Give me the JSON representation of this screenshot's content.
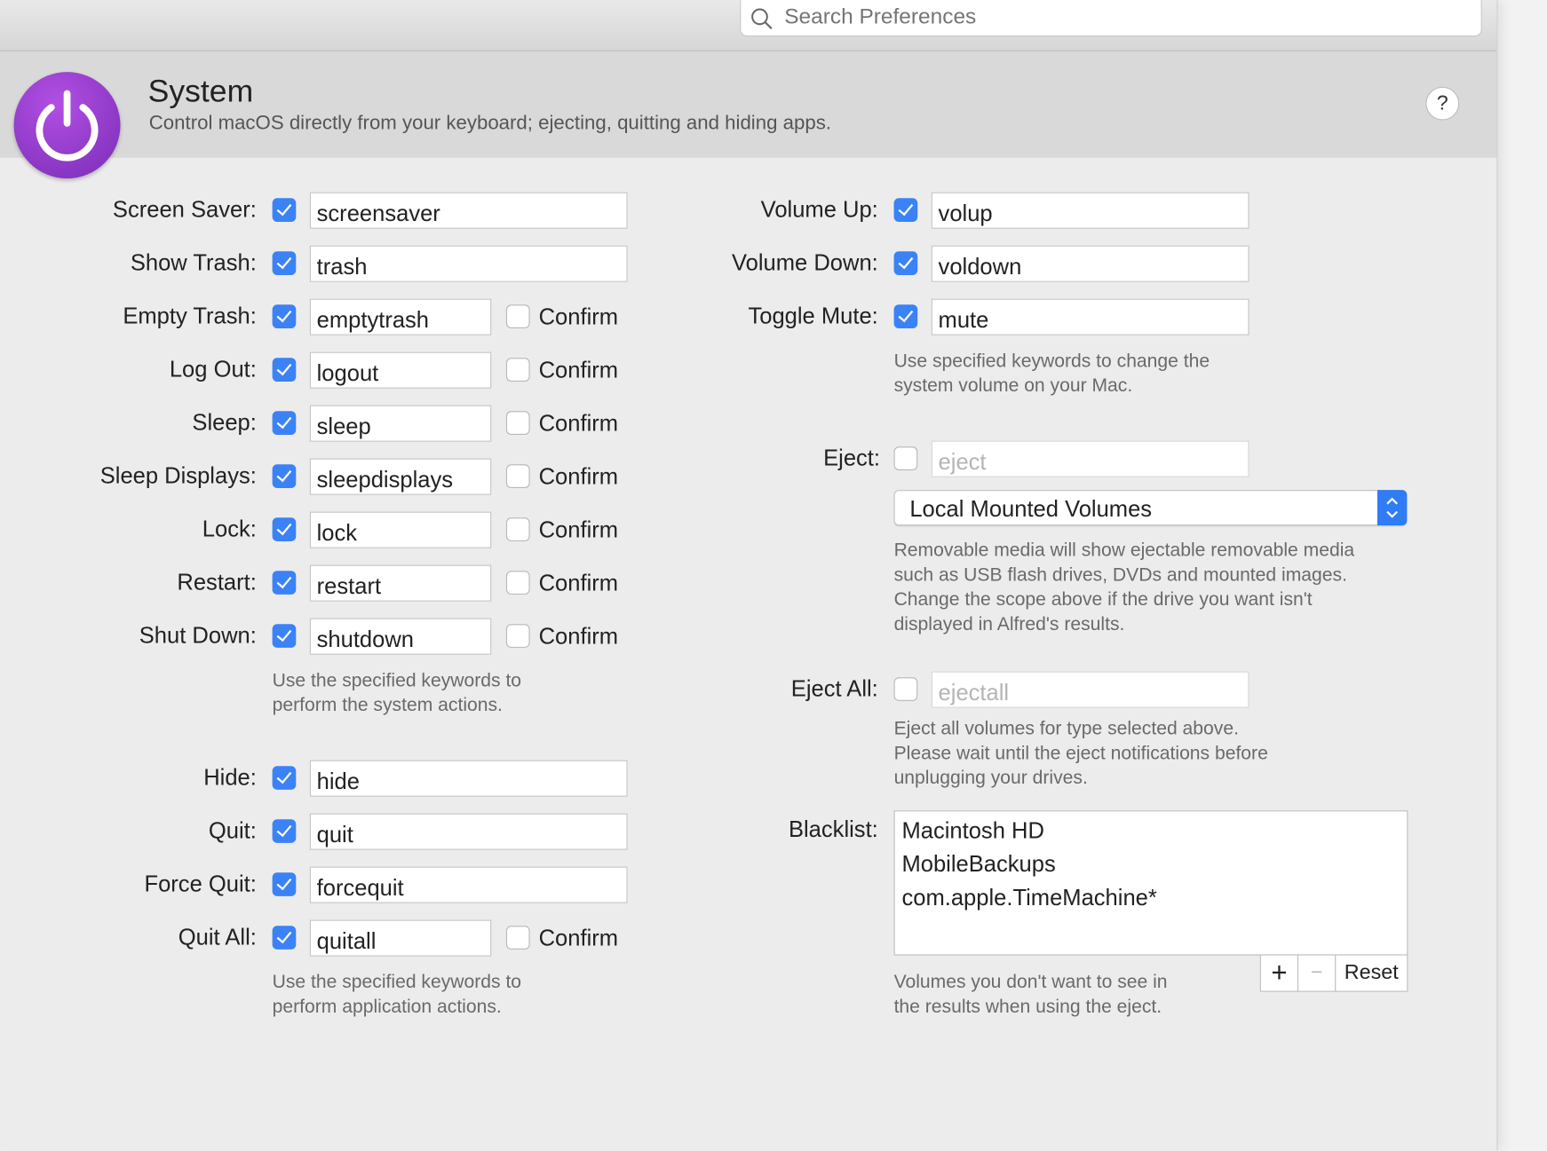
{
  "search": {
    "placeholder": "Search Preferences"
  },
  "header": {
    "title": "System",
    "subtitle": "Control macOS directly from your keyboard; ejecting, quitting and hiding apps.",
    "help_label": "?"
  },
  "confirm_label": "Confirm",
  "system_actions": [
    {
      "label": "Screen Saver:",
      "enabled": true,
      "keyword": "screensaver"
    },
    {
      "label": "Show Trash:",
      "enabled": true,
      "keyword": "trash"
    },
    {
      "label": "Empty Trash:",
      "enabled": true,
      "keyword": "emptytrash",
      "confirm": false
    },
    {
      "label": "Log Out:",
      "enabled": true,
      "keyword": "logout",
      "confirm": false
    },
    {
      "label": "Sleep:",
      "enabled": true,
      "keyword": "sleep",
      "confirm": false
    },
    {
      "label": "Sleep Displays:",
      "enabled": true,
      "keyword": "sleepdisplays",
      "confirm": false
    },
    {
      "label": "Lock:",
      "enabled": true,
      "keyword": "lock",
      "confirm": false
    },
    {
      "label": "Restart:",
      "enabled": true,
      "keyword": "restart",
      "confirm": false
    },
    {
      "label": "Shut Down:",
      "enabled": true,
      "keyword": "shutdown",
      "confirm": false
    }
  ],
  "system_note": [
    "Use the specified keywords to",
    "perform the system actions."
  ],
  "app_actions": [
    {
      "label": "Hide:",
      "enabled": true,
      "keyword": "hide"
    },
    {
      "label": "Quit:",
      "enabled": true,
      "keyword": "quit"
    },
    {
      "label": "Force Quit:",
      "enabled": true,
      "keyword": "forcequit"
    },
    {
      "label": "Quit All:",
      "enabled": true,
      "keyword": "quitall",
      "confirm": false
    }
  ],
  "app_note": [
    "Use the specified keywords to",
    "perform application actions."
  ],
  "volume_actions": [
    {
      "label": "Volume Up:",
      "enabled": true,
      "keyword": "volup"
    },
    {
      "label": "Volume Down:",
      "enabled": true,
      "keyword": "voldown"
    },
    {
      "label": "Toggle Mute:",
      "enabled": true,
      "keyword": "mute"
    }
  ],
  "volume_note": [
    "Use specified keywords to change the",
    "system volume on your Mac."
  ],
  "eject": {
    "label": "Eject:",
    "enabled": false,
    "keyword": "eject"
  },
  "scope": {
    "selected": "Local Mounted Volumes"
  },
  "scope_note": [
    "Removable media will show ejectable removable media",
    "such as USB flash drives, DVDs and mounted images.",
    "Change the scope above if the drive you want isn't",
    "displayed in Alfred's results."
  ],
  "eject_all": {
    "label": "Eject All:",
    "enabled": false,
    "keyword": "ejectall"
  },
  "eject_all_note": [
    "Eject all volumes for type selected above.",
    "Please wait until the eject notifications before",
    "unplugging your drives."
  ],
  "blacklist": {
    "label": "Blacklist:",
    "items": [
      "Macintosh HD",
      "MobileBackups",
      "com.apple.TimeMachine*"
    ],
    "add_label": "+",
    "remove_label": "−",
    "reset_label": "Reset"
  },
  "blacklist_note": [
    "Volumes you don't want to see in",
    "the results when using the eject."
  ],
  "colors": {
    "accent": "#3b82f6",
    "icon": "#8a37c4"
  }
}
